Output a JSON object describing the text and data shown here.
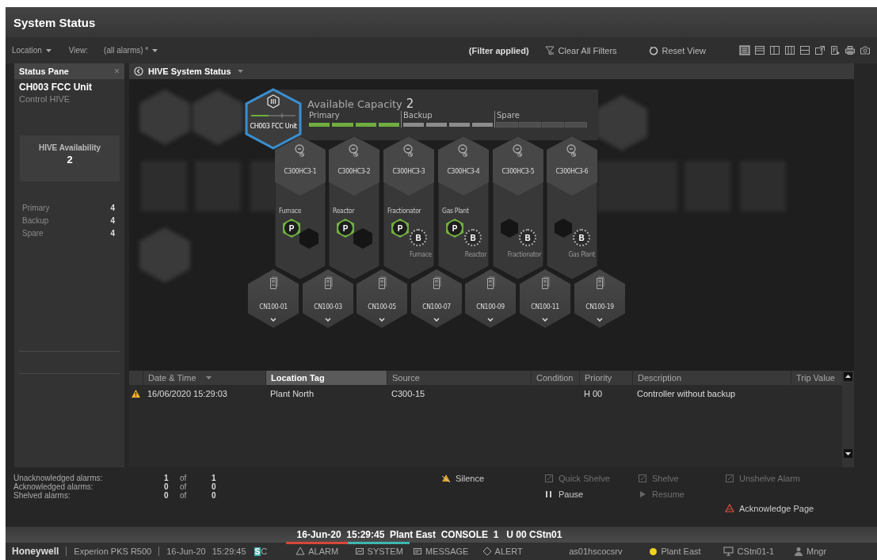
{
  "window": {
    "title": "System Status"
  },
  "toolbar": {
    "location": "Location",
    "view_label": "View:",
    "view_value": "(all alarms) *",
    "filter_note": "(Filter applied)",
    "clear_filters": "Clear All Filters",
    "reset_view": "Reset View",
    "view_modes": [
      {
        "selected": true
      },
      {
        "selected": false
      },
      {
        "selected": false
      },
      {
        "selected": false
      },
      {
        "selected": false
      }
    ]
  },
  "status_pane": {
    "title": "Status Pane",
    "close": "×",
    "unit": "CH003 FCC Unit",
    "subtitle": "Control HIVE",
    "availability_label": "HIVE Availability",
    "availability_value": "2",
    "counts": [
      {
        "label": "Primary",
        "value": "4"
      },
      {
        "label": "Backup",
        "value": "4"
      },
      {
        "label": "Spare",
        "value": "4"
      }
    ]
  },
  "hive": {
    "title": "HIVE System Status",
    "unit": {
      "name": "CH003 FCC Unit",
      "selected": true
    },
    "capacity_label": "Available Capacity",
    "capacity_value": "2",
    "groups": [
      {
        "label": "Primary",
        "kind": "primary"
      },
      {
        "label": "Backup",
        "kind": "backup"
      },
      {
        "label": "Spare",
        "kind": "spare"
      }
    ],
    "controllers": [
      {
        "name": "C300HC3-1",
        "function": "Furnace",
        "primary": {
          "kind": "active",
          "label": "P"
        },
        "backup": {
          "kind": "empty"
        }
      },
      {
        "name": "C300HC3-2",
        "function": "Reactor",
        "primary": {
          "kind": "active",
          "label": "P"
        },
        "backup": {
          "kind": "empty"
        }
      },
      {
        "name": "C300HC3-3",
        "function": "Fractionator",
        "primary": {
          "kind": "active",
          "label": "P"
        },
        "backup": {
          "kind": "standby",
          "label": "B",
          "for": "Furnace"
        }
      },
      {
        "name": "C300HC3-4",
        "function": "Gas Plant",
        "primary": {
          "kind": "active",
          "label": "P"
        },
        "backup": {
          "kind": "standby",
          "label": "B",
          "for": "Reactor"
        }
      },
      {
        "name": "C300HC3-5",
        "primary": {
          "kind": "empty"
        },
        "backup": {
          "kind": "standby",
          "label": "B",
          "for": "Fractionator"
        }
      },
      {
        "name": "C300HC3-6",
        "primary": {
          "kind": "empty"
        },
        "backup": {
          "kind": "standby",
          "label": "B",
          "for": "Gas Plant"
        }
      }
    ],
    "nodes": [
      {
        "name": "CN100-01"
      },
      {
        "name": "CN100-03"
      },
      {
        "name": "CN100-05"
      },
      {
        "name": "CN100-07"
      },
      {
        "name": "CN100-09"
      },
      {
        "name": "CN100-11"
      },
      {
        "name": "CN100-19"
      }
    ]
  },
  "alarm_table": {
    "columns": [
      {
        "label": "Date & Time",
        "selected": false,
        "sorted": true
      },
      {
        "label": "Location Tag",
        "selected": true,
        "sorted": false
      },
      {
        "label": "Source",
        "selected": false,
        "sorted": false
      },
      {
        "label": "Condition",
        "selected": false,
        "sorted": false
      },
      {
        "label": "Priority",
        "selected": false,
        "sorted": false
      },
      {
        "label": "Description",
        "selected": false,
        "sorted": false
      },
      {
        "label": "Trip Value",
        "selected": false,
        "sorted": false
      }
    ],
    "rows": [
      {
        "kind": "warning",
        "date_time": "16/06/2020 15:29:03",
        "location_tag": "Plant North",
        "source": "C300-15",
        "priority": "H 00",
        "description": "Controller without backup"
      }
    ]
  },
  "summary": [
    {
      "label": "Unacknowledged alarms:",
      "count": "1",
      "of": "of",
      "total": "1"
    },
    {
      "label": "Acknowledged alarms:",
      "count": "0",
      "of": "of",
      "total": "0"
    },
    {
      "label": "Shelved alarms:",
      "count": "0",
      "of": "of",
      "total": "0"
    }
  ],
  "actions": [
    {
      "kind": "silence",
      "label": "Silence",
      "disabled": false
    },
    {
      "kind": "quick_shelve",
      "label": "Quick Shelve",
      "disabled": true
    },
    {
      "kind": "shelve",
      "label": "Shelve",
      "disabled": true
    },
    {
      "kind": "unshelve",
      "label": "Unshelve Alarm",
      "disabled": true
    },
    {
      "kind": "pause",
      "label": "Pause",
      "disabled": false
    },
    {
      "kind": "resume",
      "label": "Resume",
      "disabled": true
    },
    {
      "kind": "acknowledge",
      "label": "Acknowledge Page",
      "disabled": false
    }
  ],
  "status_bar": {
    "console_line": "16-Jun-20  15:29:45  Plant East  CONSOLE  1   U 00 CStn01",
    "brand": "Honeywell",
    "product": "Experion PKS R500",
    "date": "16-Jun-20",
    "time": "15:29:45",
    "mode_box": "S",
    "mode": "C",
    "tabs": [
      {
        "kind": "alarm",
        "label": "ALARM",
        "color": "#d9453a"
      },
      {
        "kind": "system",
        "label": "SYSTEM",
        "color": "#3fb6b0"
      },
      {
        "kind": "message",
        "label": "MESSAGE"
      },
      {
        "kind": "alert",
        "label": "ALERT"
      }
    ],
    "server": "as01hscocsrv",
    "area": {
      "label": "Plant East",
      "color": "#f2d21b"
    },
    "station": "CStn01-1",
    "user": "Mngr"
  }
}
